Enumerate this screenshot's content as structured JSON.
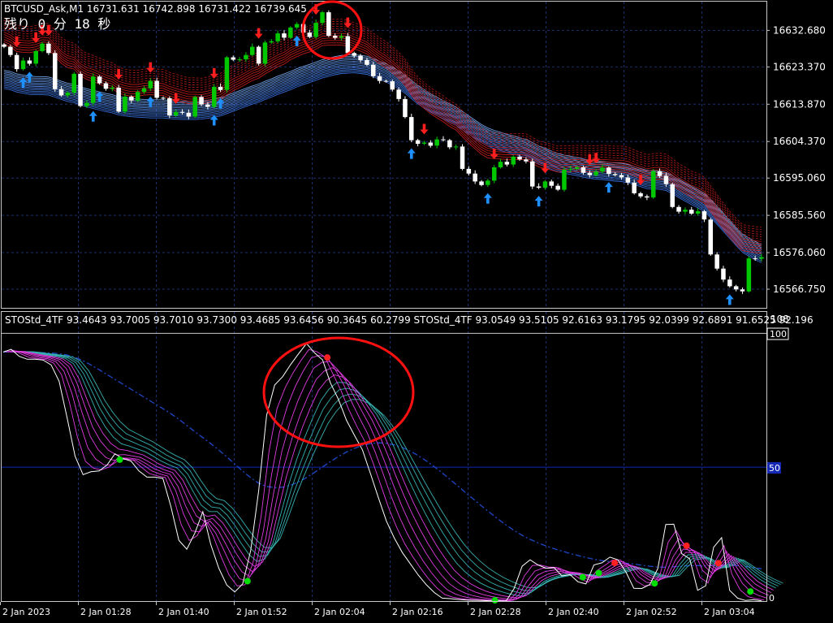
{
  "colors": {
    "background": "#000000",
    "grid": "#1e2f6e",
    "frame": "#c8c8c8",
    "text": "#ffffff",
    "bull_candle": "#00c800",
    "bear_candle": "#ffffff",
    "ribbon_red": "#d21e1e",
    "ribbon_blue": "#3c78f0",
    "sto_white": "#ffffff",
    "sto_magenta": "#e03ce0",
    "sto_teal": "#36b0b0",
    "sto_slow": "#1e46c8",
    "mid_line": "#1428b4",
    "up_arrow": "#1e90ff",
    "down_arrow": "#ff1e1e",
    "dot_green": "#00e000",
    "dot_red": "#ff2020",
    "highlight_circle": "#ff1010"
  },
  "header": {
    "symbol_line": "BTCUSD_Ask,M1  16731.631 16742.898 16731.422 16739.645",
    "timer_text": "残り 0 分 18 秒"
  },
  "indicator": {
    "label": "STOStd_4TF 93.4643 93.7005 93.7010 93.7300 93.4685 93.6456 90.3645 60.2799   STOStd_4TF 93.0549 93.5105 92.6163 93.1795 92.0399 92.6891 91.6525 92.196",
    "max_label": "108",
    "level_high_label": "100",
    "level_mid_label": "50",
    "level_low_label": "0"
  },
  "chart_data": [
    {
      "type": "candlestick",
      "title": "BTCUSD_Ask,M1",
      "timeframe": "M1",
      "ohlc_last": {
        "open": 16731.631,
        "high": 16742.898,
        "low": 16731.422,
        "close": 16739.645
      },
      "ylim": [
        16562.0,
        16640.0
      ],
      "y_ticks": [
        16632.68,
        16623.37,
        16613.87,
        16604.37,
        16595.06,
        16585.56,
        16576.06,
        16566.75
      ],
      "x_ticks": [
        "2 Jan 2023",
        "2 Jan 01:28",
        "2 Jan 01:40",
        "2 Jan 01:52",
        "2 Jan 02:04",
        "2 Jan 02:16",
        "2 Jan 02:28",
        "2 Jan 02:40",
        "2 Jan 02:52",
        "2 Jan 03:04"
      ],
      "grid": true,
      "close": [
        16628.5,
        16626.4,
        16622.8,
        16625.0,
        16624.2,
        16627.4,
        16629.3,
        16626.9,
        16617.7,
        16616.1,
        16616.8,
        16621.6,
        16613.4,
        16614.2,
        16620.9,
        16619.2,
        16617.8,
        16618.1,
        16612.0,
        16615.8,
        16614.8,
        16617.0,
        16617.9,
        16619.8,
        16615.5,
        16615.4,
        16611.0,
        16611.9,
        16611.7,
        16610.7,
        16615.7,
        16613.8,
        16613.2,
        16618.3,
        16617.5,
        16625.8,
        16625.2,
        16625.3,
        16626.4,
        16628.5,
        16624.2,
        16629.6,
        16629.9,
        16631.9,
        16630.8,
        16633.4,
        16634.3,
        16632.1,
        16631.0,
        16634.6,
        16637.3,
        16631.3,
        16630.8,
        16631.2,
        16626.9,
        16626.2,
        16625.1,
        16623.9,
        16621.0,
        16619.8,
        16619.7,
        16617.6,
        16615.2,
        16610.6,
        16604.7,
        16603.8,
        16604.1,
        16603.3,
        16604.9,
        16604.7,
        16602.9,
        16603.1,
        16597.4,
        16596.2,
        16594.2,
        16593.3,
        16594.4,
        16597.8,
        16599.2,
        16598.5,
        16600.5,
        16599.8,
        16599.3,
        16592.9,
        16592.6,
        16594.2,
        16593.1,
        16592.1,
        16597.2,
        16597.4,
        16597.8,
        16596.4,
        16595.8,
        16596.7,
        16597.7,
        16596.1,
        16595.8,
        16595.2,
        16593.9,
        16591.2,
        16590.4,
        16590.1,
        16596.8,
        16595.6,
        16593.5,
        16587.7,
        16586.5,
        16587.0,
        16586.0,
        16586.6,
        16584.5,
        16575.6,
        16572.0,
        16569.2,
        16567.5,
        16566.7,
        16566.2,
        16574.6,
        16574.5,
        16574.9
      ],
      "ribbon_red_base": [
        16629.2,
        16628.5,
        16627.3,
        16627.1,
        16627.0,
        16627.3,
        16627.9,
        16627.8,
        16626.1,
        16624.3,
        16623.2,
        16622.8,
        16621.2,
        16620.2,
        16619.7,
        16619.0,
        16618.3,
        16617.8,
        16616.7,
        16616.2,
        16615.9,
        16615.9,
        16616.2,
        16616.3,
        16616.2,
        16616.1,
        16615.4,
        16614.9,
        16614.4,
        16614.0,
        16614.0,
        16613.9,
        16614.2,
        16614.7,
        16615.1,
        16616.3,
        16617.3,
        16618.1,
        16619.0,
        16619.9,
        16620.5,
        16621.6,
        16622.5,
        16623.4,
        16624.1,
        16625.2,
        16626.0,
        16626.7,
        16627.2,
        16627.9,
        16628.8,
        16628.9,
        16628.9,
        16628.9,
        16628.7,
        16628.0,
        16627.4,
        16626.7,
        16625.4,
        16624.2,
        16623.2,
        16621.9,
        16620.5,
        16618.7,
        16616.2,
        16614.2,
        16612.8,
        16611.5,
        16610.4,
        16609.4,
        16608.2,
        16607.3,
        16605.6,
        16604.0,
        16602.5,
        16601.1,
        16600.2,
        16600.0,
        16599.9,
        16599.8,
        16599.8,
        16599.8,
        16599.7,
        16598.8,
        16597.9,
        16597.5,
        16597.1,
        16596.6,
        16596.7,
        16596.7,
        16596.8,
        16596.7,
        16596.7,
        16596.7,
        16596.8,
        16596.7,
        16596.6,
        16596.6,
        16596.3,
        16595.6,
        16595.0,
        16594.4,
        16594.7,
        16594.8,
        16594.6,
        16593.4,
        16592.1,
        16591.2,
        16590.2,
        16589.6,
        16588.7,
        16586.5,
        16584.3,
        16582.1,
        16580.0,
        16578.2,
        16576.6,
        16576.3,
        16576.1,
        16575.9
      ],
      "ribbon_blue_base": [
        16622.5,
        16622.2,
        16621.6,
        16621.3,
        16621.0,
        16620.9,
        16620.9,
        16620.8,
        16620.3,
        16619.7,
        16619.2,
        16618.9,
        16618.3,
        16617.8,
        16617.4,
        16617.0,
        16616.6,
        16616.3,
        16615.8,
        16615.5,
        16615.3,
        16615.2,
        16615.1,
        16615.0,
        16615.0,
        16615.0,
        16614.8,
        16614.7,
        16614.6,
        16614.6,
        16614.6,
        16614.7,
        16614.9,
        16615.2,
        16615.5,
        16616.1,
        16616.7,
        16617.3,
        16617.9,
        16618.5,
        16619.0,
        16619.7,
        16620.3,
        16621.0,
        16621.6,
        16622.2,
        16622.9,
        16623.5,
        16624.0,
        16624.6,
        16625.2,
        16625.6,
        16626.0,
        16626.3,
        16626.4,
        16626.5,
        16626.3,
        16626.1,
        16625.5,
        16624.8,
        16624.2,
        16623.3,
        16622.4,
        16621.3,
        16619.9,
        16618.6,
        16617.6,
        16616.5,
        16615.6,
        16614.8,
        16613.9,
        16613.1,
        16612.0,
        16610.9,
        16609.8,
        16608.7,
        16607.8,
        16607.2,
        16606.7,
        16606.2,
        16605.8,
        16605.3,
        16604.9,
        16604.1,
        16603.2,
        16602.6,
        16601.9,
        16601.3,
        16600.9,
        16600.6,
        16600.3,
        16599.9,
        16599.6,
        16599.4,
        16599.3,
        16599.1,
        16598.9,
        16598.8,
        16598.5,
        16598.0,
        16597.5,
        16597.0,
        16596.9,
        16596.8,
        16596.5,
        16595.7,
        16594.7,
        16593.8,
        16592.9,
        16592.1,
        16591.2,
        16589.6,
        16587.9,
        16586.1,
        16584.3,
        16582.5,
        16580.8,
        16579.8,
        16578.9,
        16578.1
      ],
      "up_arrows_at": [
        3,
        4,
        14,
        15,
        23,
        33,
        34,
        46,
        64,
        76,
        84,
        95,
        114
      ],
      "down_arrows_at": [
        2,
        5,
        6,
        7,
        18,
        23,
        27,
        33,
        40,
        49,
        54,
        66,
        77,
        85,
        92,
        93,
        100
      ]
    },
    {
      "type": "line",
      "title": "STOStd_4TF",
      "ylim": [
        0,
        108
      ],
      "levels": [
        0,
        50,
        100
      ],
      "series": [
        {
          "name": "STOStd_4TF",
          "values": [
            93.0,
            94.0,
            91.4,
            90.3,
            90.3,
            90.0,
            88.2,
            82.1,
            68.4,
            54.1,
            47.2,
            48.3,
            48.6,
            50.8,
            55.0,
            53.2,
            52.3,
            48.6,
            46.3,
            46.3,
            45.8,
            35.3,
            22.7,
            19.4,
            25.4,
            33.4,
            21.1,
            12.3,
            6.0,
            3.4,
            6.4,
            18.9,
            41.2,
            69.4,
            80.7,
            83.8,
            88.3,
            92.4,
            96.2,
            92.7,
            90.1,
            81.4,
            75.3,
            67.5,
            61.9,
            56.5,
            47.6,
            38.6,
            29.9,
            23.5,
            18.1,
            13.9,
            9.7,
            6.1,
            3.2,
            1.1,
            0.9,
            0.6,
            0.4,
            0.3,
            0.2,
            0.1,
            0.1,
            0.0,
            4.7,
            13.0,
            15.4,
            13.5,
            12.3,
            12.5,
            9.4,
            9.9,
            7.2,
            6.4,
            13.5,
            14.3,
            16.4,
            15.4,
            10.9,
            4.8,
            4.7,
            6.2,
            12.1,
            28.6,
            28.7,
            17.7,
            15.8,
            4.0,
            5.7,
            20.1,
            23.7,
            4.0,
            1.1,
            0.2,
            0.5,
            0.1
          ]
        }
      ]
    }
  ]
}
